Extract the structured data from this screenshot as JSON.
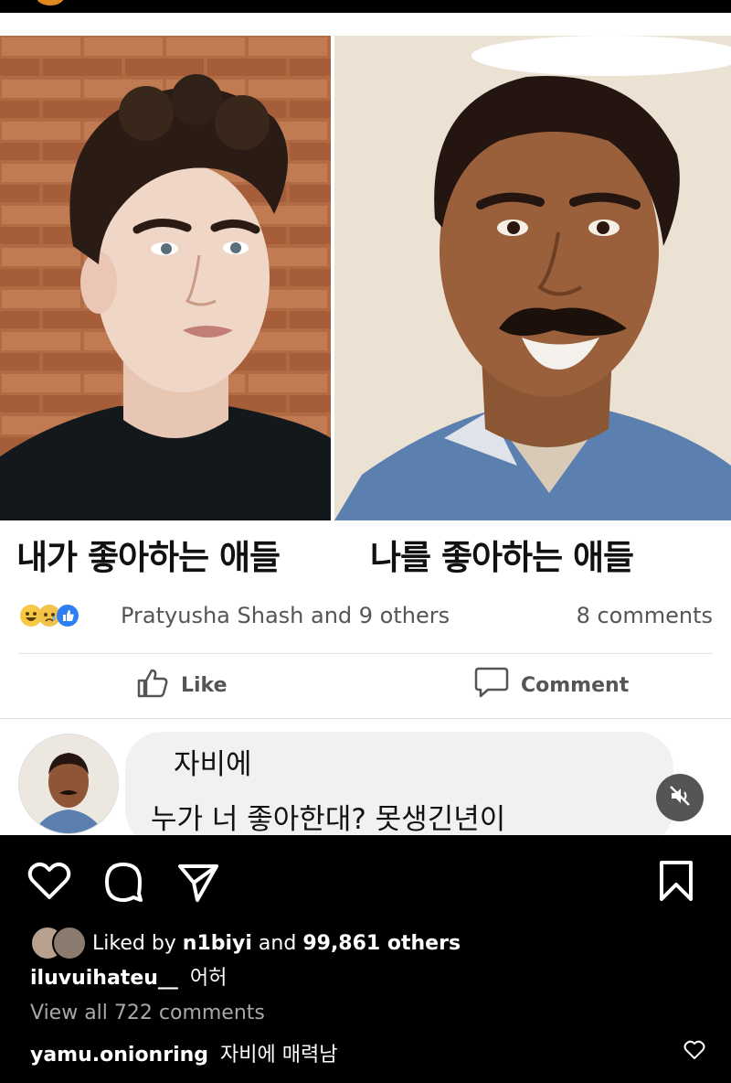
{
  "post": {
    "caption_left": "내가 좋아하는 애들",
    "caption_right": "나를 좋아하는 애들",
    "reactions_text": "Pratyusha Shash and 9 others",
    "comments_count": "8 comments",
    "like_label": "Like",
    "comment_label": "Comment",
    "comment_line1": "자비에",
    "comment_line2": "누가 너 좋아한대? 못생긴년이"
  },
  "instagram": {
    "liked_by_prefix": "Liked by ",
    "liked_by_user": "n1biyi",
    "liked_by_and": " and ",
    "liked_by_count": "99,861 others",
    "caption_user": "iluvuihateu__",
    "caption_text": "어허",
    "view_comments": "View all 722 comments",
    "top_comment_user": "yamu.onionring",
    "top_comment_text": "자비에 매력남"
  },
  "icons": {
    "like": "heart-icon",
    "comment": "comment-bubble-icon",
    "share": "send-icon",
    "save": "bookmark-icon",
    "mute": "muted-speaker-icon"
  }
}
